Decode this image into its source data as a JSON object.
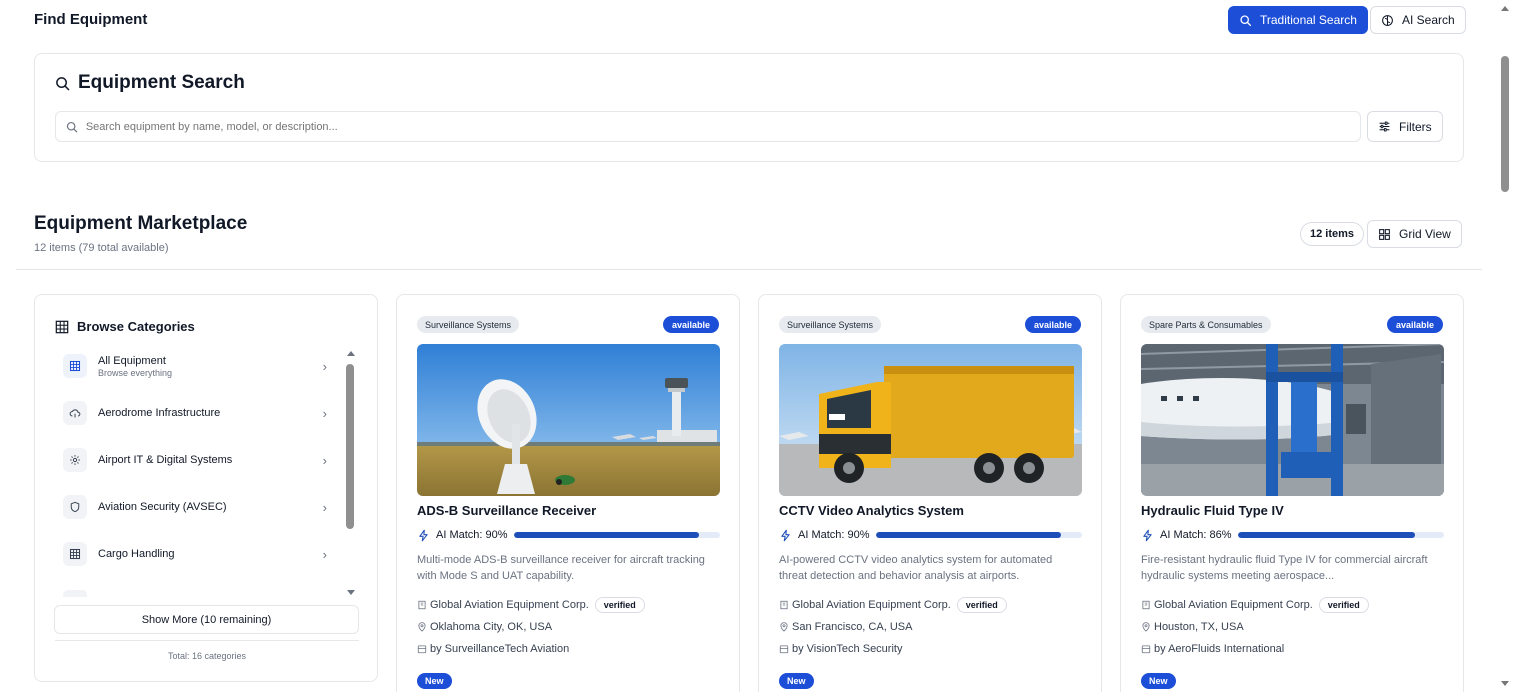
{
  "header": {
    "title": "Find Equipment",
    "traditional_search_label": "Traditional Search",
    "ai_search_label": "AI Search"
  },
  "search": {
    "title": "Equipment Search",
    "placeholder": "Search equipment by name, model, or description...",
    "filters_label": "Filters"
  },
  "marketplace": {
    "title": "Equipment Marketplace",
    "subtitle": "12 items (79 total available)",
    "count_pill": "12 items",
    "view_label": "Grid View"
  },
  "categories": {
    "title": "Browse Categories",
    "items": [
      {
        "label": "All Equipment",
        "desc": "Browse everything",
        "icon": "grid-icon"
      },
      {
        "label": "Aerodrome Infrastructure",
        "desc": "",
        "icon": "cloud-icon"
      },
      {
        "label": "Airport IT & Digital Systems",
        "desc": "",
        "icon": "gear-icon"
      },
      {
        "label": "Aviation Security (AVSEC)",
        "desc": "",
        "icon": "shield-icon"
      },
      {
        "label": "Cargo Handling",
        "desc": "",
        "icon": "grid-icon"
      }
    ],
    "show_more_label": "Show More (10 remaining)",
    "total_label": "Total: 16 categories"
  },
  "cards": [
    {
      "category": "Surveillance Systems",
      "status": "available",
      "title": "ADS-B Surveillance Receiver",
      "match_label": "AI Match: 90%",
      "match": 90,
      "description": "Multi-mode ADS-B surveillance receiver for aircraft tracking with Mode S and UAT capability.",
      "supplier": "Global Aviation Equipment Corp.",
      "verified": "verified",
      "location": "Oklahoma City, OK, USA",
      "seller": "by SurveillanceTech Aviation",
      "badge": "New"
    },
    {
      "category": "Surveillance Systems",
      "status": "available",
      "title": "CCTV Video Analytics System",
      "match_label": "AI Match: 90%",
      "match": 90,
      "description": "AI-powered CCTV video analytics system for automated threat detection and behavior analysis at airports.",
      "supplier": "Global Aviation Equipment Corp.",
      "verified": "verified",
      "location": "San Francisco, CA, USA",
      "seller": "by VisionTech Security",
      "badge": "New"
    },
    {
      "category": "Spare Parts & Consumables",
      "status": "available",
      "title": "Hydraulic Fluid Type IV",
      "match_label": "AI Match: 86%",
      "match": 86,
      "description": "Fire-resistant hydraulic fluid Type IV for commercial aircraft hydraulic systems meeting aerospace...",
      "supplier": "Global Aviation Equipment Corp.",
      "verified": "verified",
      "location": "Houston, TX, USA",
      "seller": "by AeroFluids International",
      "badge": "New"
    }
  ],
  "colors": {
    "primary": "#1d4ed8",
    "match_bar": "#1e4fb8",
    "match_track": "#e3ebf9"
  }
}
